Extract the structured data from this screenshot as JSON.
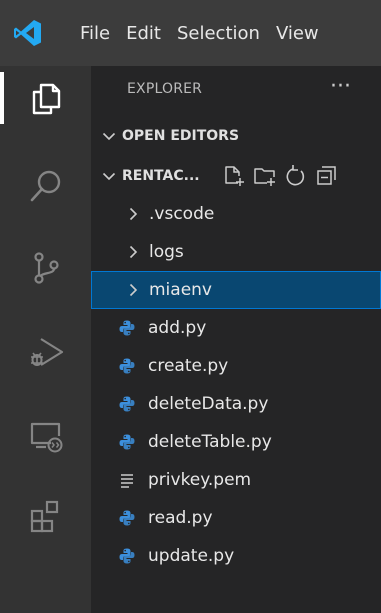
{
  "menu": [
    "File",
    "Edit",
    "Selection",
    "View"
  ],
  "explorer": {
    "title": "EXPLORER",
    "more": "···"
  },
  "sections": {
    "open_editors": "OPEN EDITORS",
    "project": "RENTAC..."
  },
  "tree": {
    "folders": [
      ".vscode",
      "logs",
      "miaenv"
    ],
    "selected_folder": "miaenv",
    "files": [
      {
        "name": "add.py",
        "icon": "python-icon"
      },
      {
        "name": "create.py",
        "icon": "python-icon"
      },
      {
        "name": "deleteData.py",
        "icon": "python-icon"
      },
      {
        "name": "deleteTable.py",
        "icon": "python-icon"
      },
      {
        "name": "privkey.pem",
        "icon": "text-file-icon"
      },
      {
        "name": "read.py",
        "icon": "python-icon"
      },
      {
        "name": "update.py",
        "icon": "python-icon"
      }
    ]
  },
  "colors": {
    "titlebar": "#3c3c3c",
    "activitybar": "#333333",
    "sidebar": "#252526",
    "selection": "#094771",
    "selection_border": "#0078d4",
    "vscode_blue": "#23a9f2",
    "python_blue": "#3c8fdc"
  }
}
